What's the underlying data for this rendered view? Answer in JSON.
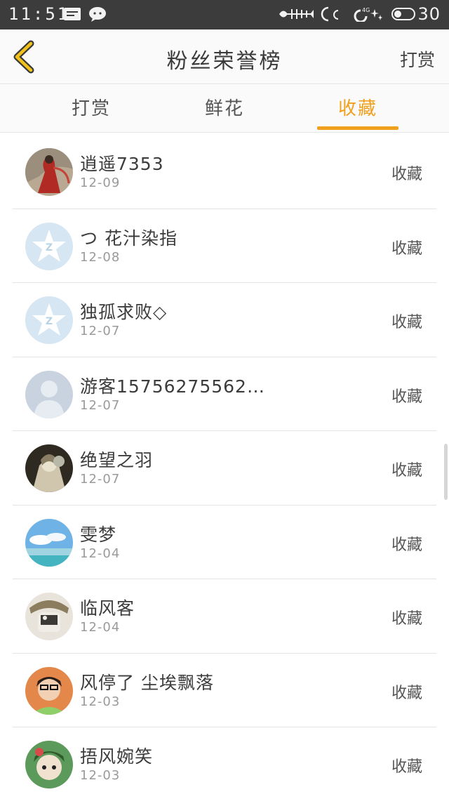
{
  "status_bar": {
    "time": "11:51",
    "battery": "30",
    "icons": [
      "message-icon",
      "wechat-icon",
      "fish-bone-icon",
      "moon-icon",
      "4g-signal-icon",
      "battery-icon"
    ]
  },
  "header": {
    "title": "粉丝荣誉榜",
    "action": "打赏",
    "back_icon": "chevron-left-icon",
    "accent": "#f0a01d"
  },
  "tabs": [
    {
      "label": "打赏",
      "active": false
    },
    {
      "label": "鲜花",
      "active": false
    },
    {
      "label": "收藏",
      "active": true
    }
  ],
  "list": [
    {
      "name": "逍遥7353",
      "date": "12-09",
      "tag": "收藏"
    },
    {
      "name": "つ 花汁染指",
      "date": "12-08",
      "tag": "收藏"
    },
    {
      "name": "独孤求败◇",
      "date": "12-07",
      "tag": "收藏"
    },
    {
      "name": "游客15756275562…",
      "date": "12-07",
      "tag": "收藏"
    },
    {
      "name": "绝望之羽",
      "date": "12-07",
      "tag": "收藏"
    },
    {
      "name": "雯梦",
      "date": "12-04",
      "tag": "收藏"
    },
    {
      "name": "临风客",
      "date": "12-04",
      "tag": "收藏"
    },
    {
      "name": "风停了 尘埃飘落",
      "date": "12-03",
      "tag": "收藏"
    },
    {
      "name": "捂风婉笑",
      "date": "12-03",
      "tag": "收藏"
    }
  ]
}
